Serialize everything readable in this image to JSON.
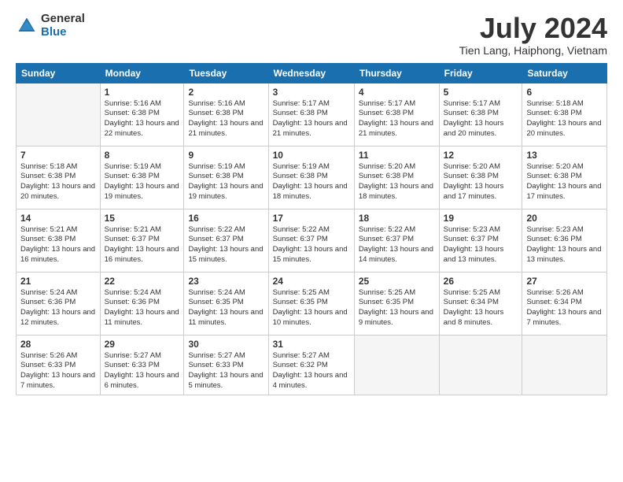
{
  "logo": {
    "general": "General",
    "blue": "Blue"
  },
  "title": "July 2024",
  "subtitle": "Tien Lang, Haiphong, Vietnam",
  "days_of_week": [
    "Sunday",
    "Monday",
    "Tuesday",
    "Wednesday",
    "Thursday",
    "Friday",
    "Saturday"
  ],
  "weeks": [
    [
      {
        "day": "",
        "info": ""
      },
      {
        "day": "1",
        "info": "Sunrise: 5:16 AM\nSunset: 6:38 PM\nDaylight: 13 hours\nand 22 minutes."
      },
      {
        "day": "2",
        "info": "Sunrise: 5:16 AM\nSunset: 6:38 PM\nDaylight: 13 hours\nand 21 minutes."
      },
      {
        "day": "3",
        "info": "Sunrise: 5:17 AM\nSunset: 6:38 PM\nDaylight: 13 hours\nand 21 minutes."
      },
      {
        "day": "4",
        "info": "Sunrise: 5:17 AM\nSunset: 6:38 PM\nDaylight: 13 hours\nand 21 minutes."
      },
      {
        "day": "5",
        "info": "Sunrise: 5:17 AM\nSunset: 6:38 PM\nDaylight: 13 hours\nand 20 minutes."
      },
      {
        "day": "6",
        "info": "Sunrise: 5:18 AM\nSunset: 6:38 PM\nDaylight: 13 hours\nand 20 minutes."
      }
    ],
    [
      {
        "day": "7",
        "info": "Sunrise: 5:18 AM\nSunset: 6:38 PM\nDaylight: 13 hours\nand 20 minutes."
      },
      {
        "day": "8",
        "info": "Sunrise: 5:19 AM\nSunset: 6:38 PM\nDaylight: 13 hours\nand 19 minutes."
      },
      {
        "day": "9",
        "info": "Sunrise: 5:19 AM\nSunset: 6:38 PM\nDaylight: 13 hours\nand 19 minutes."
      },
      {
        "day": "10",
        "info": "Sunrise: 5:19 AM\nSunset: 6:38 PM\nDaylight: 13 hours\nand 18 minutes."
      },
      {
        "day": "11",
        "info": "Sunrise: 5:20 AM\nSunset: 6:38 PM\nDaylight: 13 hours\nand 18 minutes."
      },
      {
        "day": "12",
        "info": "Sunrise: 5:20 AM\nSunset: 6:38 PM\nDaylight: 13 hours\nand 17 minutes."
      },
      {
        "day": "13",
        "info": "Sunrise: 5:20 AM\nSunset: 6:38 PM\nDaylight: 13 hours\nand 17 minutes."
      }
    ],
    [
      {
        "day": "14",
        "info": "Sunrise: 5:21 AM\nSunset: 6:38 PM\nDaylight: 13 hours\nand 16 minutes."
      },
      {
        "day": "15",
        "info": "Sunrise: 5:21 AM\nSunset: 6:37 PM\nDaylight: 13 hours\nand 16 minutes."
      },
      {
        "day": "16",
        "info": "Sunrise: 5:22 AM\nSunset: 6:37 PM\nDaylight: 13 hours\nand 15 minutes."
      },
      {
        "day": "17",
        "info": "Sunrise: 5:22 AM\nSunset: 6:37 PM\nDaylight: 13 hours\nand 15 minutes."
      },
      {
        "day": "18",
        "info": "Sunrise: 5:22 AM\nSunset: 6:37 PM\nDaylight: 13 hours\nand 14 minutes."
      },
      {
        "day": "19",
        "info": "Sunrise: 5:23 AM\nSunset: 6:37 PM\nDaylight: 13 hours\nand 13 minutes."
      },
      {
        "day": "20",
        "info": "Sunrise: 5:23 AM\nSunset: 6:36 PM\nDaylight: 13 hours\nand 13 minutes."
      }
    ],
    [
      {
        "day": "21",
        "info": "Sunrise: 5:24 AM\nSunset: 6:36 PM\nDaylight: 13 hours\nand 12 minutes."
      },
      {
        "day": "22",
        "info": "Sunrise: 5:24 AM\nSunset: 6:36 PM\nDaylight: 13 hours\nand 11 minutes."
      },
      {
        "day": "23",
        "info": "Sunrise: 5:24 AM\nSunset: 6:35 PM\nDaylight: 13 hours\nand 11 minutes."
      },
      {
        "day": "24",
        "info": "Sunrise: 5:25 AM\nSunset: 6:35 PM\nDaylight: 13 hours\nand 10 minutes."
      },
      {
        "day": "25",
        "info": "Sunrise: 5:25 AM\nSunset: 6:35 PM\nDaylight: 13 hours\nand 9 minutes."
      },
      {
        "day": "26",
        "info": "Sunrise: 5:25 AM\nSunset: 6:34 PM\nDaylight: 13 hours\nand 8 minutes."
      },
      {
        "day": "27",
        "info": "Sunrise: 5:26 AM\nSunset: 6:34 PM\nDaylight: 13 hours\nand 7 minutes."
      }
    ],
    [
      {
        "day": "28",
        "info": "Sunrise: 5:26 AM\nSunset: 6:33 PM\nDaylight: 13 hours\nand 7 minutes."
      },
      {
        "day": "29",
        "info": "Sunrise: 5:27 AM\nSunset: 6:33 PM\nDaylight: 13 hours\nand 6 minutes."
      },
      {
        "day": "30",
        "info": "Sunrise: 5:27 AM\nSunset: 6:33 PM\nDaylight: 13 hours\nand 5 minutes."
      },
      {
        "day": "31",
        "info": "Sunrise: 5:27 AM\nSunset: 6:32 PM\nDaylight: 13 hours\nand 4 minutes."
      },
      {
        "day": "",
        "info": ""
      },
      {
        "day": "",
        "info": ""
      },
      {
        "day": "",
        "info": ""
      }
    ]
  ]
}
